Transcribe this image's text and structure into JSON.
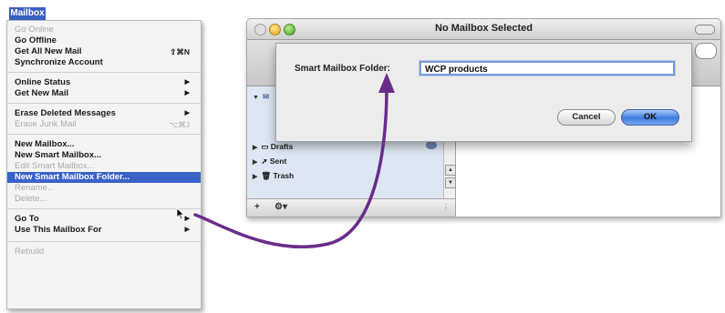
{
  "menu": {
    "title": "Mailbox",
    "items": [
      {
        "label": "Go Online",
        "disabled": true
      },
      {
        "label": "Go Offline"
      },
      {
        "label": "Get All New Mail",
        "shortcut": "⇧⌘N"
      },
      {
        "label": "Synchronize Account"
      },
      {
        "label": "Online Status",
        "submenu": "▶"
      },
      {
        "label": "Get New Mail",
        "submenu": "▶"
      },
      {
        "label": "Erase Deleted Messages",
        "submenu": "▶"
      },
      {
        "label": "Erase Junk Mail",
        "shortcut": "⌥⌘J",
        "disabled": true
      },
      {
        "label": "New Mailbox..."
      },
      {
        "label": "New Smart Mailbox..."
      },
      {
        "label": "Edit Smart Mailbox...",
        "disabled": true
      },
      {
        "label": "New Smart Mailbox Folder...",
        "highlighted": true
      },
      {
        "label": "Rename...",
        "disabled": true
      },
      {
        "label": "Delete...",
        "disabled": true
      },
      {
        "label": "Go To",
        "submenu": "▶"
      },
      {
        "label": "Use This Mailbox For",
        "submenu": "▶"
      },
      {
        "label": "Rebuild",
        "disabled": true
      }
    ]
  },
  "window": {
    "title": "No Mailbox Selected",
    "sidebar": {
      "rows": [
        {
          "label": "Drafts"
        },
        {
          "label": "Sent"
        },
        {
          "label": "Trash"
        }
      ],
      "add_button": "+",
      "action_button": "⚙▾"
    }
  },
  "sheet": {
    "label": "Smart Mailbox Folder:",
    "input_value": "WCP products",
    "cancel_label": "Cancel",
    "ok_label": "OK"
  },
  "colors": {
    "menu_highlight": "#3a63c8",
    "default_button": "#3d7be0",
    "annotation_arrow": "#6a2c8a"
  }
}
